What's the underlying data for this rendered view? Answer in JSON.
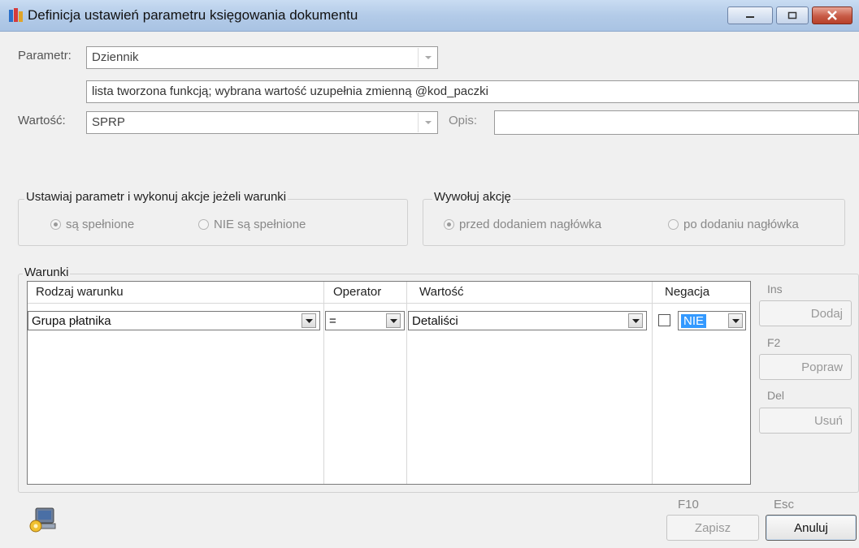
{
  "window": {
    "title": "Definicja ustawień parametru księgowania dokumentu",
    "icon": "app-books-icon",
    "controls": [
      "minimize-icon",
      "maximize-icon",
      "close-icon"
    ]
  },
  "param": {
    "label": "Parametr:",
    "value": "Dziennik",
    "description": "lista tworzona funkcją; wybrana wartość uzupełnia zmienną @kod_paczki"
  },
  "value_row": {
    "label": "Wartość:",
    "value": "SPRP",
    "opis_label": "Opis:",
    "opis_value": ""
  },
  "conditions_group": {
    "title": "Ustawiaj parametr i wykonuj akcje jeżeli warunki",
    "option1": "są spełnione",
    "option2": "NIE są spełnione",
    "selected": "option1"
  },
  "action_group": {
    "title": "Wywołuj akcję",
    "option1": "przed dodaniem nagłówka",
    "option2": "po dodaniu nagłówka",
    "selected": "option1"
  },
  "warunki": {
    "title": "Warunki",
    "columns": [
      "Rodzaj warunku",
      "Operator",
      "Wartość",
      "Negacja"
    ],
    "row": {
      "rodzaj": "Grupa płatnika",
      "operator": "=",
      "wartosc": "Detaliści",
      "negacja_checked": false,
      "negacja": "NIE"
    }
  },
  "side_buttons": {
    "ins_key": "Ins",
    "add_label": "Dodaj",
    "f2_key": "F2",
    "edit_label": "Popraw",
    "del_key": "Del",
    "delete_label": "Usuń"
  },
  "footer": {
    "save_key": "F10",
    "save_label": "Zapisz",
    "cancel_key": "Esc",
    "cancel_label": "Anuluj",
    "icon": "settings-computer-icon"
  }
}
